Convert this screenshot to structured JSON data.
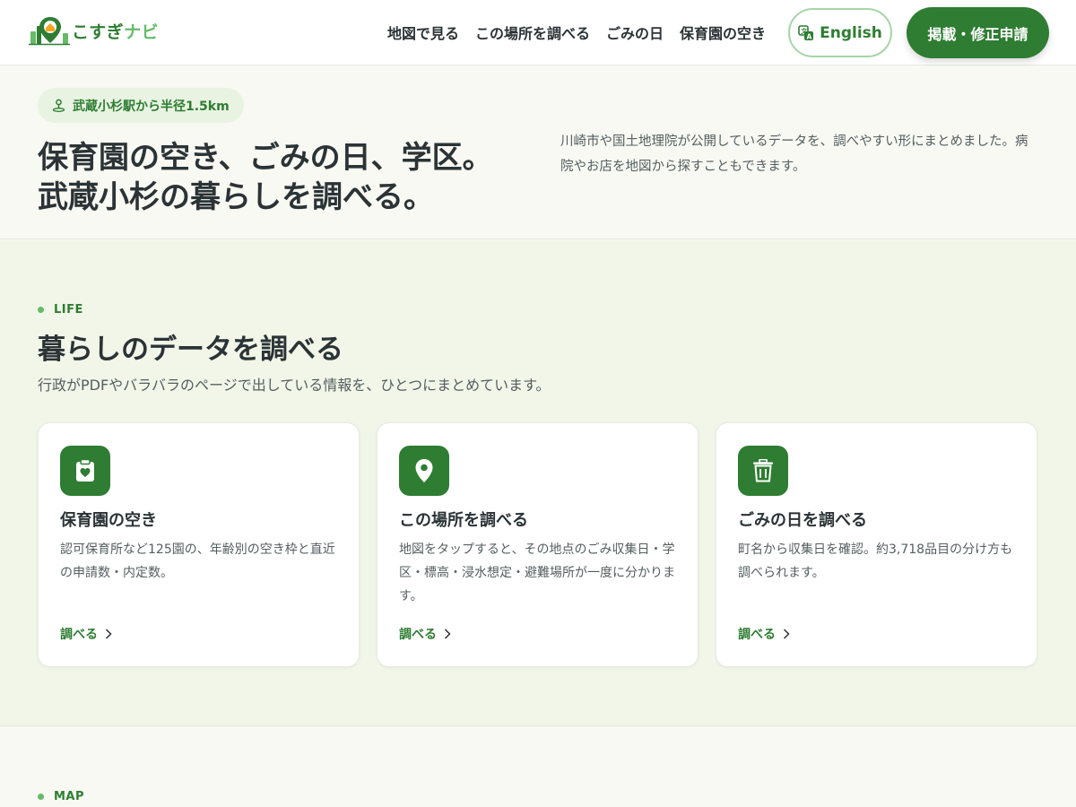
{
  "header": {
    "logo_text_main": "こすぎ",
    "logo_text_accent": "ナビ",
    "nav": [
      {
        "label": "地図で見る"
      },
      {
        "label": "この場所を調べる"
      },
      {
        "label": "ごみの日"
      },
      {
        "label": "保育園の空き"
      }
    ],
    "english_label": "English",
    "submit_label": "掲載・修正申請"
  },
  "hero": {
    "pill": "武蔵小杉駅から半径1.5km",
    "title_line1": "保育園の空き、ごみの日、学区。",
    "title_line2": "武蔵小杉の暮らしを調べる。",
    "description": "川崎市や国土地理院が公開しているデータを、調べやすい形にまとめました。病院やお店を地図から探すこともできます。"
  },
  "life": {
    "eyebrow": "LIFE",
    "title": "暮らしのデータを調べる",
    "subtitle": "行政がPDFやバラバラのページで出している情報を、ひとつにまとめています。",
    "cards": [
      {
        "icon": "clipboard-heart-icon",
        "title": "保育園の空き",
        "description": "認可保育所など125園の、年齢別の空き枠と直近の申請数・内定数。",
        "link": "調べる"
      },
      {
        "icon": "map-pin-icon",
        "title": "この場所を調べる",
        "description": "地図をタップすると、その地点のごみ収集日・学区・標高・浸水想定・避難場所が一度に分かります。",
        "link": "調べる"
      },
      {
        "icon": "trash-icon",
        "title": "ごみの日を調べる",
        "description": "町名から収集日を確認。約3,718品目の分け方も調べられます。",
        "link": "調べる"
      }
    ]
  },
  "map": {
    "eyebrow": "MAP"
  },
  "colors": {
    "brand": "#2e7d32",
    "brand_light": "#66bb6a",
    "hero_bg": "#f7f9f2",
    "section_bg": "#f1f6e8"
  }
}
